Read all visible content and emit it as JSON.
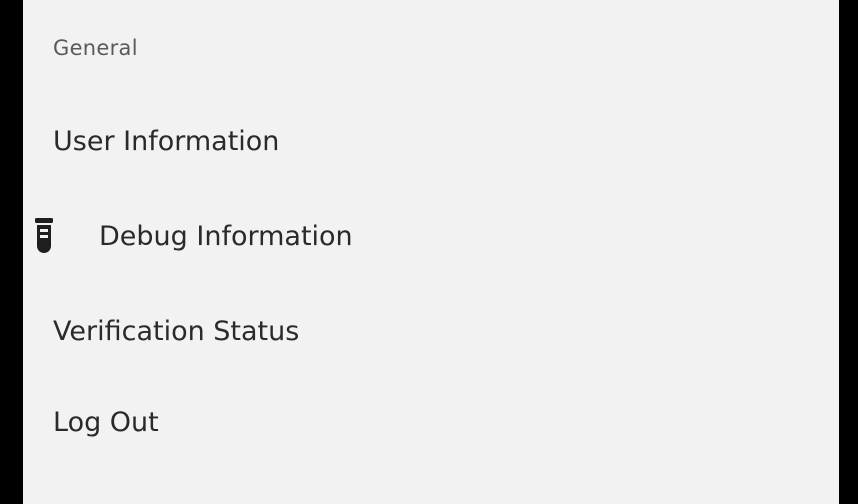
{
  "menu": {
    "section_header": "General",
    "items": [
      {
        "label": "User Information",
        "icon": null
      },
      {
        "label": "Debug Information",
        "icon": "test-tube-icon"
      },
      {
        "label": "Verification Status",
        "icon": null
      },
      {
        "label": "Log Out",
        "icon": null
      }
    ]
  },
  "colors": {
    "panel_background": "#f2f2f2",
    "outer_background": "#000000",
    "text_primary": "#2a2a2a",
    "text_secondary": "#5a5a5a",
    "icon": "#1e1e1e"
  }
}
